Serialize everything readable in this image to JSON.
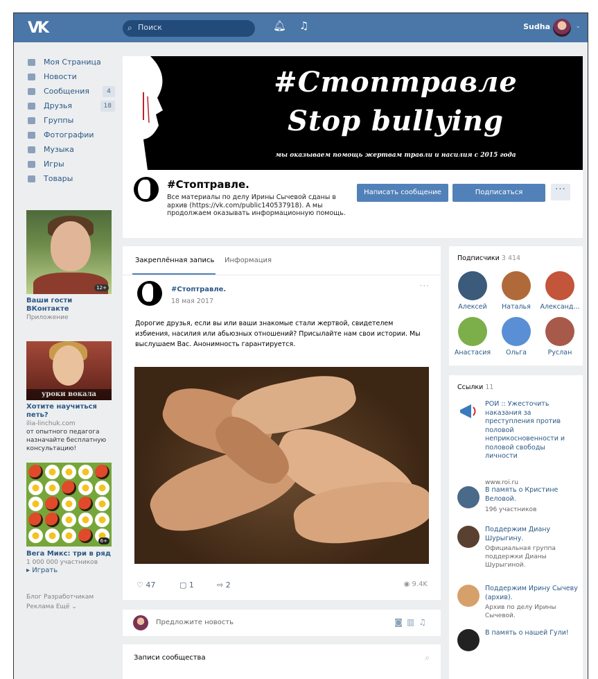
{
  "topbar": {
    "logo": "VK",
    "search_placeholder": "Поиск",
    "user_name": "Sudha"
  },
  "nav": [
    {
      "label": "Моя Страница",
      "icon": "home-icon",
      "badge": ""
    },
    {
      "label": "Новости",
      "icon": "news-icon",
      "badge": ""
    },
    {
      "label": "Сообщения",
      "icon": "messages-icon",
      "badge": "4"
    },
    {
      "label": "Друзья",
      "icon": "friends-icon",
      "badge": "18"
    },
    {
      "label": "Группы",
      "icon": "groups-icon",
      "badge": ""
    },
    {
      "label": "Фотографии",
      "icon": "camera-icon",
      "badge": ""
    },
    {
      "label": "Музыка",
      "icon": "music-icon",
      "badge": ""
    },
    {
      "label": "Игры",
      "icon": "games-icon",
      "badge": ""
    },
    {
      "label": "Товары",
      "icon": "goods-icon",
      "badge": ""
    }
  ],
  "ads": [
    {
      "badge": "12+",
      "title": "Ваши гости ВКонтакте",
      "sub": "Приложение",
      "text": ""
    },
    {
      "img_caption": "уроки вокала",
      "title": "Хотите научиться петь?",
      "sub": "ilia-linchuk.com",
      "text": "от опытного педагога назначайте бесплатную консультацию!"
    },
    {
      "badge": "6+",
      "title": "Вега Микс: три в ряд",
      "sub": "1 000 000 участников",
      "text": "▸ Играть"
    }
  ],
  "footer": {
    "line1": "Блог   Разработчикам",
    "line2": "Реклама   Ещё ⌄"
  },
  "cover": {
    "line1": "#Стоптравле",
    "line2": "Stop bullying",
    "tagline": "мы оказываем помощь жертвам травли и насилия с 2015 года"
  },
  "page": {
    "name": "#Стоптравле.",
    "status": "Все материалы по делу Ирины Сычевой сданы в архив (https://vk.com/public140537918). А мы продолжаем оказывать информационную помощь.",
    "btn_message": "Написать сообщение",
    "btn_subscribe": "Подписаться",
    "btn_more": "···"
  },
  "feed": {
    "tab_pinned": "Закреплённая запись",
    "tab_info": "Информация",
    "post": {
      "author": "#Стоптравле.",
      "date": "18 мая 2017",
      "more": "···",
      "text": "Дорогие друзья, если вы или ваши знакомые стали жертвой, свидетелем избиения, насилия или абьюзных отношений? Присылайте нам свои истории. Мы выслушаем Вас. Анонимность гарантируется.",
      "likes": "47",
      "comments": "1",
      "shares": "2",
      "views": "9.4K"
    },
    "suggest": "Предложите новость",
    "records_title": "Записи сообщества"
  },
  "subscribers": {
    "title": "Подписчики",
    "count": "3 414",
    "people": [
      {
        "name": "Алексей",
        "color": "#3c5a7a"
      },
      {
        "name": "Наталья",
        "color": "#b06a3a"
      },
      {
        "name": "Александ...",
        "color": "#c2553a"
      },
      {
        "name": "Анастасия",
        "color": "#7cae4a"
      },
      {
        "name": "Ольга",
        "color": "#5a8fd6"
      },
      {
        "name": "Руслан",
        "color": "#a85a4a"
      }
    ]
  },
  "links": {
    "title": "Ссылки",
    "count": "11",
    "items": [
      {
        "title": "РОИ :: Ужесточить наказания за преступления против половой неприкосновенности и половой свободы личности",
        "sub": "www.roi.ru",
        "color": "#3a7abf"
      },
      {
        "title": "В память о Кристине Веловой.",
        "sub": "196 участников",
        "color": "#4a6a8a"
      },
      {
        "title": "Поддержим Диану Шурыгину.",
        "sub": "Официальная группа поддержки Дианы Шурыгиной.",
        "color": "#5a4030"
      },
      {
        "title": "Поддержим Ирину Сычеву (архив).",
        "sub": "Архив по делу Ирины Сычевой.",
        "color": "#d6a06a"
      },
      {
        "title": "В память о нашей Гули!",
        "sub": "",
        "color": "#222222"
      }
    ]
  }
}
